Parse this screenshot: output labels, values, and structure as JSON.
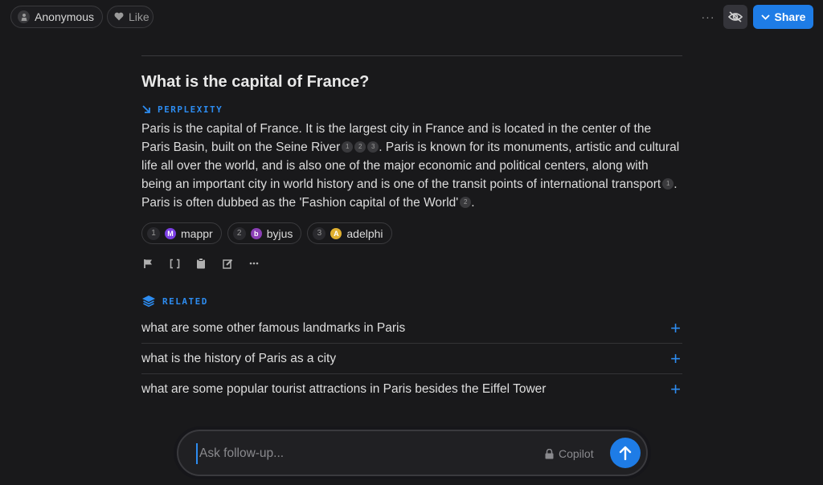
{
  "topbar": {
    "user_label": "Anonymous",
    "like_label": "Like",
    "more_label": "···",
    "share_label": "Share"
  },
  "thread": {
    "question": "What is the capital of France?",
    "source_label": "PERPLEXITY",
    "answer_segments": [
      {
        "text": "Paris is the capital of France. It is the largest city in France and is located in the center of the Paris Basin, built on the Seine River",
        "cites": [
          "1",
          "2",
          "3"
        ]
      },
      {
        "text": ". Paris is known for its monuments, artistic and cultural life all over the world, and is also one of the major economic and political centers, along with being an important city in world history and is one of the transit points of international transport",
        "cites": [
          "1"
        ]
      },
      {
        "text": ". Paris is often dubbed as the 'Fashion capital of the World'",
        "cites": [
          "2"
        ]
      },
      {
        "text": ".",
        "cites": []
      }
    ],
    "sources": [
      {
        "num": "1",
        "name": "mappr",
        "logo": "M",
        "color": "#7b3fe4"
      },
      {
        "num": "2",
        "name": "byjus",
        "logo": "b",
        "color": "#8a3fb5"
      },
      {
        "num": "3",
        "name": "adelphi",
        "logo": "A",
        "color": "#e0b030"
      }
    ],
    "actions": [
      "flag-icon",
      "brackets-icon",
      "clipboard-icon",
      "edit-icon",
      "more-icon"
    ]
  },
  "related": {
    "label": "RELATED",
    "items": [
      "what are some other famous landmarks in Paris",
      "what is the history of Paris as a city",
      "what are some popular tourist attractions in Paris besides the Eiffel Tower"
    ],
    "plus": "+"
  },
  "followup": {
    "placeholder": "Ask follow-up...",
    "copilot_label": "Copilot"
  },
  "colors": {
    "background": "#19191b",
    "accent": "#1e7ce6",
    "label_blue": "#2d8cf0"
  }
}
